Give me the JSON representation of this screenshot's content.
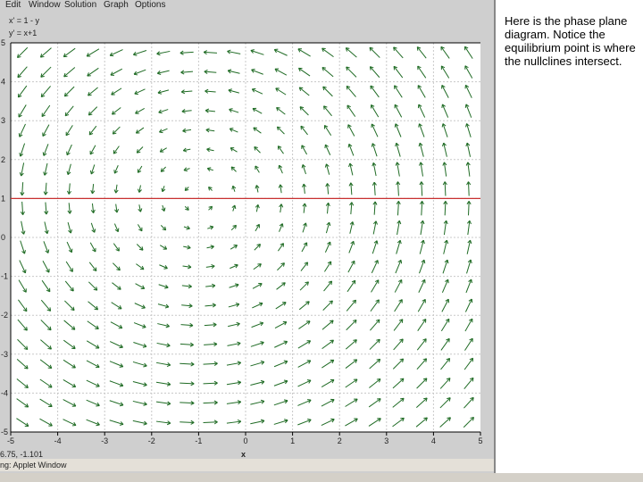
{
  "menu": [
    "Edit",
    "Window",
    "Solution",
    "Graph",
    "Options"
  ],
  "equations": {
    "x_prime": "x' = 1 - y",
    "y_prime": "y' = x+1"
  },
  "plot": {
    "x_ticks": [
      "-5",
      "-4",
      "-3",
      "-2",
      "-1",
      "0",
      "1",
      "2",
      "3",
      "4",
      "5"
    ],
    "y_ticks": [
      "5",
      "4",
      "3",
      "2",
      "1",
      "0",
      "-1",
      "-2",
      "-3",
      "-4",
      "-5"
    ],
    "x_label": "x",
    "xlim": [
      -5,
      5
    ],
    "ylim": [
      -5,
      5
    ],
    "nullcline_y": 1,
    "arrow_color": "#1f6b24",
    "nullcline_color": "#c83030"
  },
  "status": {
    "coords": "6.75, -1.101",
    "bar": "ng: Applet Window"
  },
  "note": "Here is the phase plane diagram.  Notice the equilibrium point is where the nullclines intersect."
}
